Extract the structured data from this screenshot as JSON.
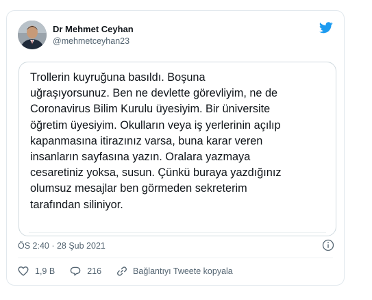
{
  "author": {
    "name": "Dr Mehmet Ceyhan",
    "handle": "@mehmetceyhan23",
    "avatar_icon": "profile-photo"
  },
  "brand": {
    "icon": "twitter-bird-icon",
    "color": "#1d9bf0"
  },
  "quote": {
    "text": "Trollerin kuyruğuna basıldı.  Boşuna\nuğraşıyorsunuz. Ben ne devlette görevliyim, ne de\nCoronavirus Bilim Kurulu üyesiyim. Bir üniversite\nöğretim üyesiyim. Okulların veya iş yerlerinin açılıp\nkapanmasına itirazınız varsa, buna karar veren\ninsanların sayfasına yazın.  Oralara yazmaya\ncesaretiniz yoksa, susun. Çünkü buraya yazdığınız\nolumsuz mesajlar ben görmeden sekreterim\ntarafından siliniyor."
  },
  "timestamp": "ÖS 2:40 · 28 Şub 2021",
  "actions": {
    "like_count": "1,9 B",
    "reply_count": "216",
    "copy_label": "Bağlantıyı Tweete kopyala"
  },
  "colors": {
    "text_primary": "#0f1419",
    "text_secondary": "#536471",
    "border": "#cfd9de"
  }
}
